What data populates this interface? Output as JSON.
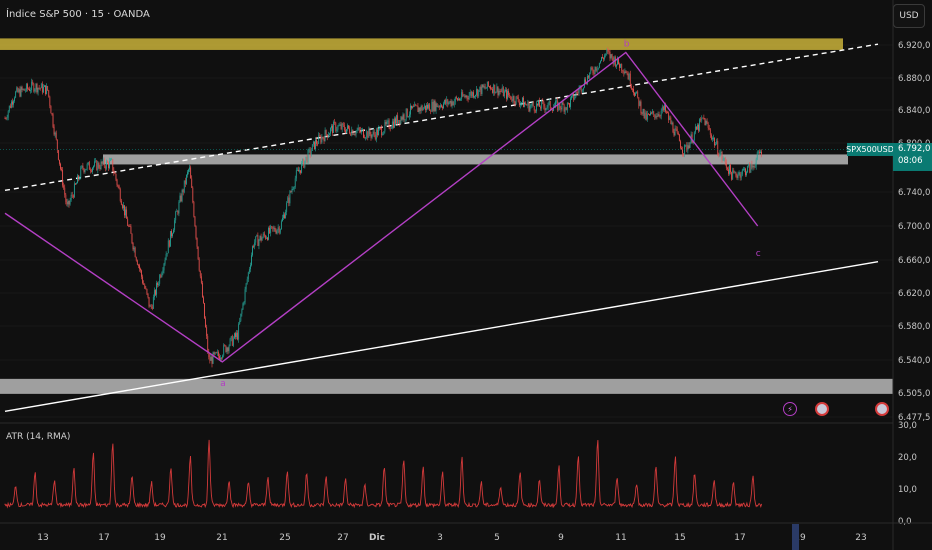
{
  "header": {
    "title": "Índice S&P 500 · 15 · OANDA",
    "currency_button": "USD"
  },
  "price_tag": {
    "symbol": "SPX500USD",
    "price": "6.792,0",
    "countdown": "08:06"
  },
  "wave_labels": [
    "a",
    "b",
    "c"
  ],
  "atr": {
    "label": "ATR (14, RMA)",
    "axis": [
      "30,0",
      "20,0",
      "10,0",
      "0,0"
    ]
  },
  "colors": {
    "background": "#101010",
    "bull": "#26a69a",
    "bear": "#ef5350",
    "wave": "#b33fc4",
    "yellow_zone": "#c9b23a",
    "grey_zone": "#b8b8b8",
    "atr_line": "#d33a3a",
    "price_tag": "#0a7a72"
  },
  "events": [
    "lightning-event-icon",
    "us-flag-event-icon",
    "us-flag-event-icon"
  ],
  "chart_data": [
    {
      "type": "candlestick",
      "title": "Índice S&P 500 · 15 · OANDA",
      "y_axis_labels": [
        "6.920,0",
        "6.880,0",
        "6.840,0",
        "6.800,0",
        "6.740,0",
        "6.700,0",
        "6.660,0",
        "6.620,0",
        "6.580,0",
        "6.540,0",
        "6.505,0",
        "6.477,5"
      ],
      "x_axis_labels": [
        "13",
        "17",
        "19",
        "21",
        "25",
        "27",
        "Dic",
        "3",
        "5",
        "9",
        "11",
        "15",
        "17",
        "19",
        "23"
      ],
      "ylim": [
        6477.5,
        6935
      ],
      "last_price": 6792.0,
      "price_path": [
        {
          "x": 0,
          "y": 6830
        },
        {
          "x": 0.5,
          "y": 6860
        },
        {
          "x": 1.5,
          "y": 6870
        },
        {
          "x": 2.2,
          "y": 6865
        },
        {
          "x": 3.2,
          "y": 6720
        },
        {
          "x": 4,
          "y": 6770
        },
        {
          "x": 5.5,
          "y": 6775
        },
        {
          "x": 7.5,
          "y": 6600
        },
        {
          "x": 9.5,
          "y": 6770
        },
        {
          "x": 10.5,
          "y": 6540
        },
        {
          "x": 11,
          "y": 6545
        },
        {
          "x": 12,
          "y": 6570
        },
        {
          "x": 12.8,
          "y": 6680
        },
        {
          "x": 14.2,
          "y": 6700
        },
        {
          "x": 15,
          "y": 6760
        },
        {
          "x": 16,
          "y": 6800
        },
        {
          "x": 17,
          "y": 6820
        },
        {
          "x": 19,
          "y": 6810
        },
        {
          "x": 21,
          "y": 6840
        },
        {
          "x": 23,
          "y": 6850
        },
        {
          "x": 25,
          "y": 6870
        },
        {
          "x": 27,
          "y": 6845
        },
        {
          "x": 29,
          "y": 6845
        },
        {
          "x": 30,
          "y": 6880
        },
        {
          "x": 31,
          "y": 6910
        },
        {
          "x": 32,
          "y": 6890
        },
        {
          "x": 33,
          "y": 6830
        },
        {
          "x": 34,
          "y": 6840
        },
        {
          "x": 35,
          "y": 6790
        },
        {
          "x": 36,
          "y": 6830
        },
        {
          "x": 37,
          "y": 6780
        },
        {
          "x": 37.5,
          "y": 6760
        },
        {
          "x": 38.5,
          "y": 6770
        },
        {
          "x": 39,
          "y": 6792
        }
      ],
      "zones": [
        {
          "name": "yellow-resistance",
          "from": 6914,
          "to": 6928,
          "color": "#c9b23a"
        },
        {
          "name": "grey-middle",
          "from": 6776,
          "to": 6786,
          "color": "#b8b8b8"
        },
        {
          "name": "grey-bottom",
          "from": 6504,
          "to": 6520,
          "color": "#b8b8b8"
        }
      ],
      "trendlines": [
        {
          "name": "upper-dashed",
          "style": "dashed",
          "from": [
            0,
            6742
          ],
          "to": [
            45,
            6921
          ]
        },
        {
          "name": "lower-solid",
          "style": "solid",
          "from": [
            0,
            6484
          ],
          "to": [
            45,
            6658
          ]
        }
      ],
      "wave": [
        {
          "label": "",
          "x": 0,
          "y": 6715
        },
        {
          "label": "a",
          "x": 11.2,
          "y": 6538
        },
        {
          "label": "b",
          "x": 32,
          "y": 6911
        },
        {
          "label": "c",
          "x": 38.8,
          "y": 6700
        }
      ]
    },
    {
      "type": "line",
      "title": "ATR (14, RMA)",
      "ylim": [
        0,
        30
      ],
      "y_axis_labels": [
        "30,0",
        "20,0",
        "10,0",
        "0,0"
      ],
      "series": [
        {
          "name": "ATR (14, RMA)",
          "color": "#d33a3a"
        }
      ],
      "cycle_days": 24,
      "peaks": [
        11,
        15,
        13,
        17,
        21,
        25,
        14,
        12,
        17,
        20,
        15,
        13,
        12,
        14,
        16,
        15,
        14,
        13,
        11,
        17,
        19,
        17,
        15,
        20,
        12
      ],
      "baseline": 5,
      "spikes": [
        {
          "x": 10.5,
          "value": 28
        },
        {
          "x": 17,
          "value": 10
        }
      ],
      "last_value": 6
    }
  ]
}
